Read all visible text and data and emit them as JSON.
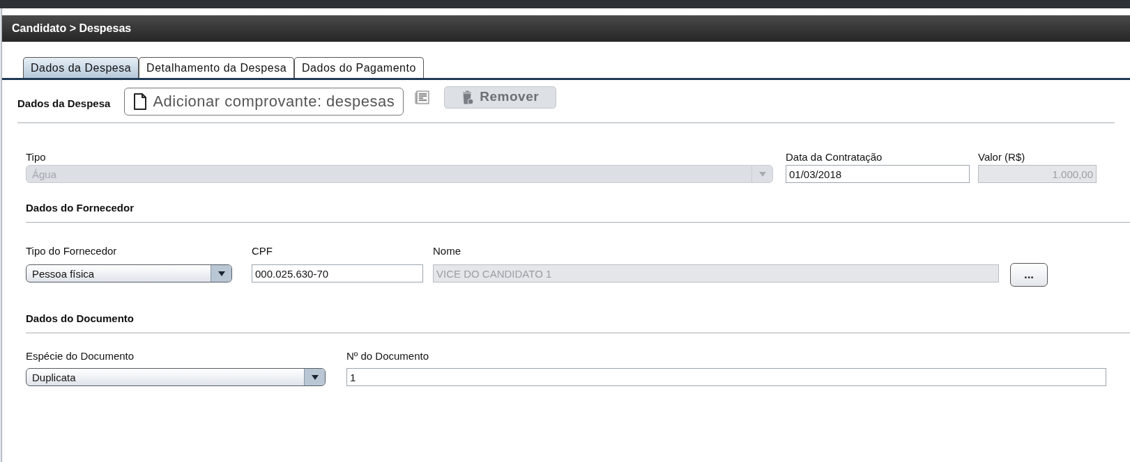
{
  "header": {
    "title": "Candidato > Despesas"
  },
  "tabs": [
    {
      "label": "Dados da Despesa",
      "selected": true
    },
    {
      "label": "Detalhamento da Despesa",
      "selected": false
    },
    {
      "label": "Dados do Pagamento",
      "selected": false
    }
  ],
  "toolbar": {
    "title": "Dados da Despesa",
    "add_button": {
      "label": "Adicionar comprovante: despesas",
      "disabled": false
    },
    "remove_button": {
      "label": "Remover",
      "disabled": true
    }
  },
  "expense": {
    "tipo": {
      "label": "Tipo",
      "value": "Água",
      "disabled": true
    },
    "data": {
      "label": "Data da Contratação",
      "value": "01/03/2018",
      "disabled": false
    },
    "valor": {
      "label": "Valor (R$)",
      "value": "1.000,00",
      "disabled": true
    }
  },
  "supplier": {
    "title": "Dados do Fornecedor",
    "tipo": {
      "label": "Tipo do Fornecedor",
      "value": "Pessoa física"
    },
    "cpf": {
      "label": "CPF",
      "value": "000.025.630-70",
      "disabled": false
    },
    "nome": {
      "label": "Nome",
      "value": "VICE DO CANDIDATO 1",
      "disabled": true
    },
    "lookup_button": "..."
  },
  "document": {
    "title": "Dados do Documento",
    "especie": {
      "label": "Espécie do Documento",
      "value": "Duplicata"
    },
    "numero": {
      "label": "Nº do Documento",
      "value": "1",
      "disabled": false
    }
  }
}
